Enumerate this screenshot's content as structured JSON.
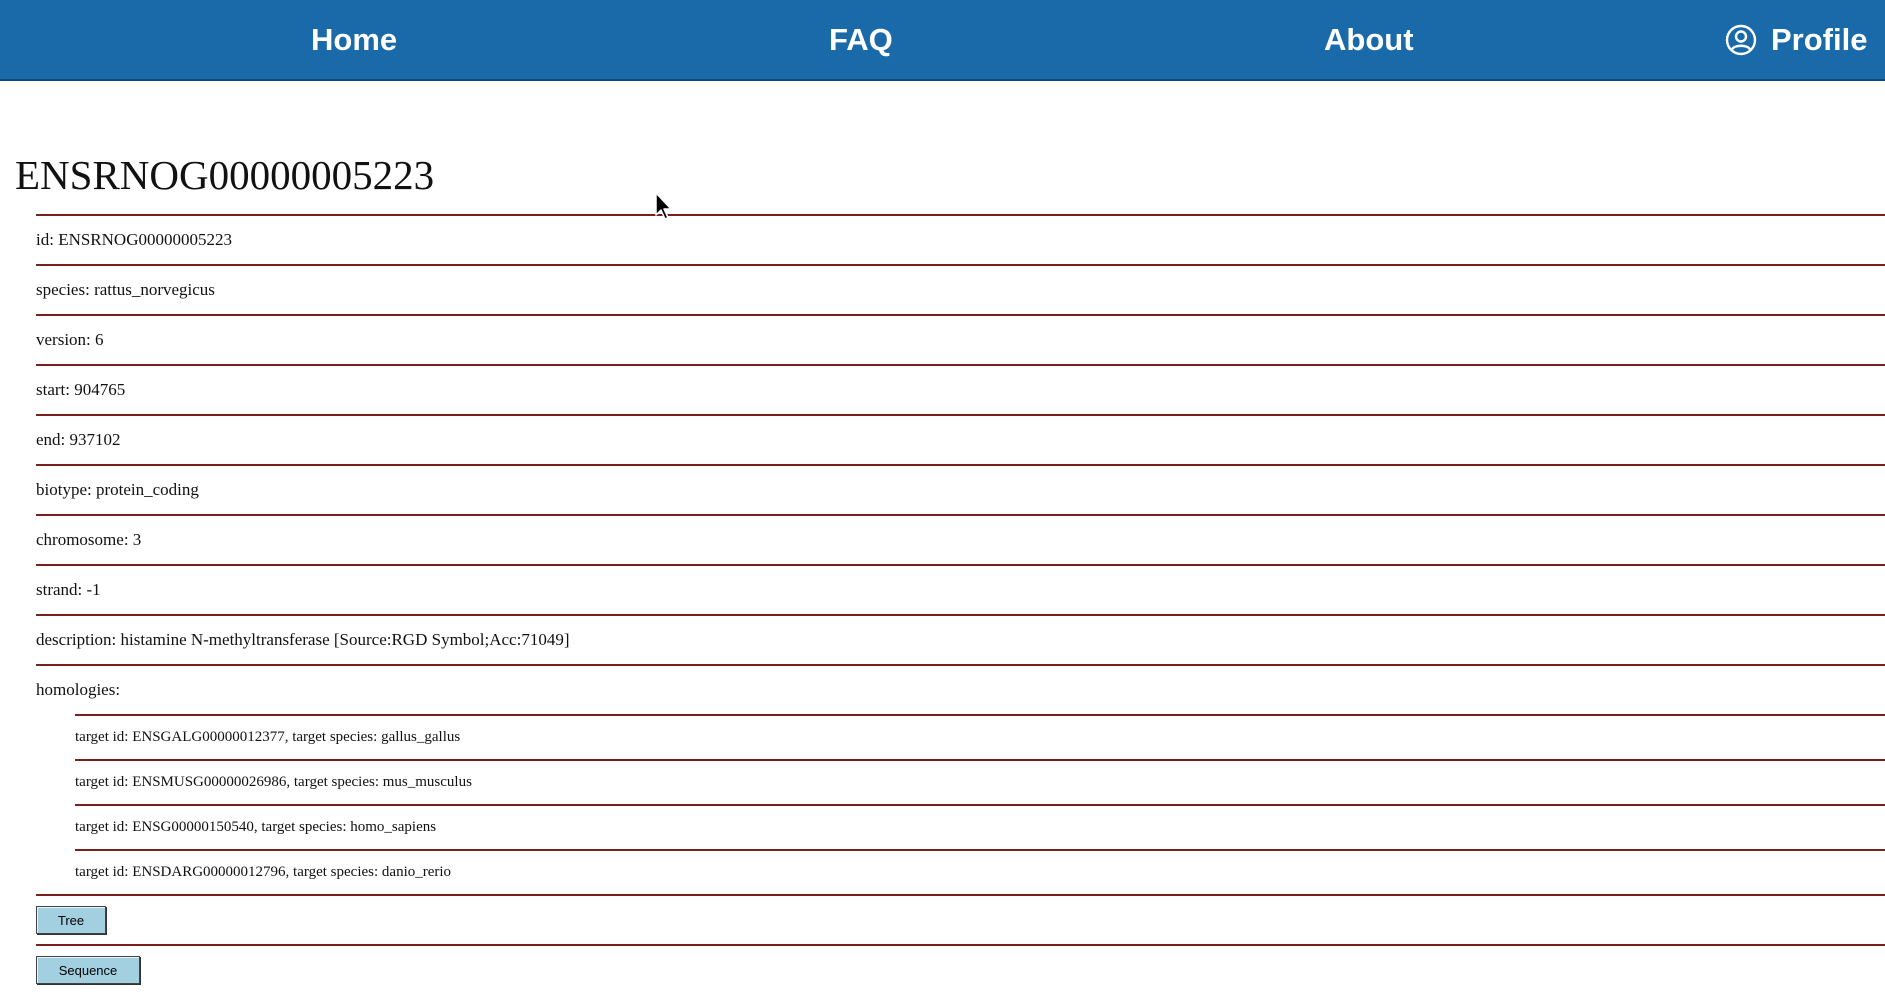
{
  "nav": {
    "home": "Home",
    "faq": "FAQ",
    "about": "About",
    "profile": "Profile",
    "profile_icon": "user-circle-icon",
    "background": "#1a6aa9"
  },
  "gene": {
    "title": "ENSRNOG00000005223",
    "fields": [
      "id: ENSRNOG00000005223",
      "species: rattus_norvegicus",
      "version: 6",
      "start: 904765",
      "end: 937102",
      "biotype: protein_coding",
      "chromosome: 3",
      "strand: -1",
      "description: histamine N-methyltransferase [Source:RGD Symbol;Acc:71049]",
      "homologies:"
    ],
    "homologies": [
      "target id: ENSGALG00000012377, target species: gallus_gallus",
      "target id: ENSMUSG00000026986, target species: mus_musculus",
      "target id: ENSG00000150540, target species: homo_sapiens",
      "target id: ENSDARG00000012796, target species: danio_rerio"
    ]
  },
  "buttons": {
    "tree": "Tree",
    "sequence": "Sequence",
    "color": "#a3d0e1"
  },
  "divider_color": "#7a1f1f"
}
